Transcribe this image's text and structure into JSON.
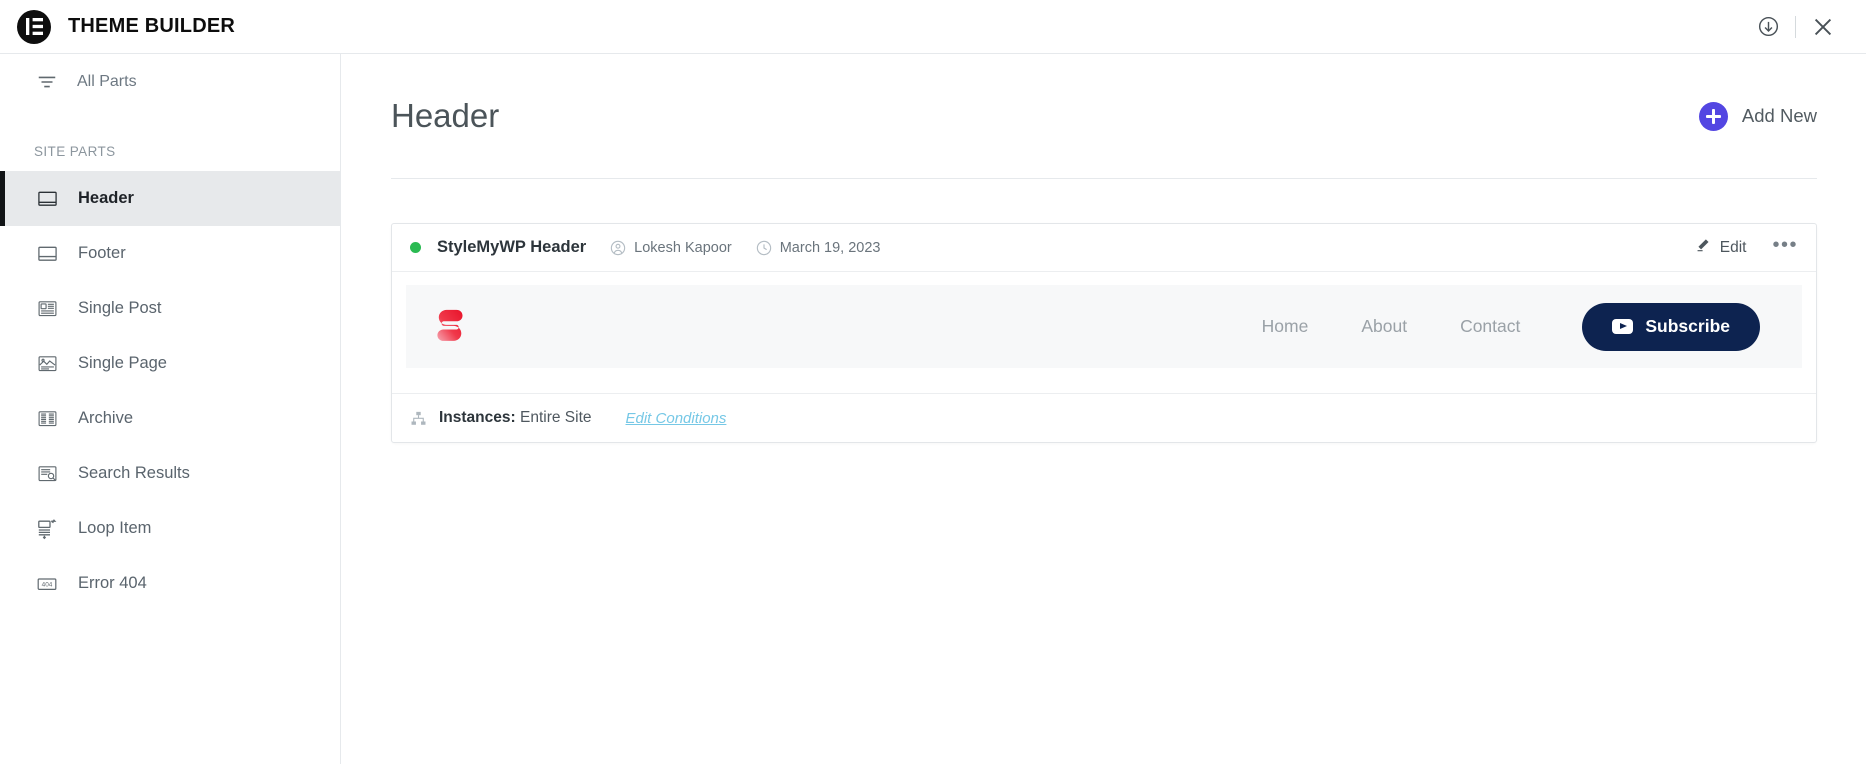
{
  "topbar": {
    "logo_icon": "elementor-logo-icon",
    "title": "THEME BUILDER",
    "save_icon": "download-circle-icon",
    "close_icon": "close-icon"
  },
  "sidebar": {
    "all_parts": {
      "label": "All Parts",
      "icon": "filter-lines-icon"
    },
    "section_label": "SITE PARTS",
    "items": [
      {
        "label": "Header",
        "icon": "header-block-icon",
        "active": true
      },
      {
        "label": "Footer",
        "icon": "footer-block-icon",
        "active": false
      },
      {
        "label": "Single Post",
        "icon": "single-post-icon",
        "active": false
      },
      {
        "label": "Single Page",
        "icon": "single-page-icon",
        "active": false
      },
      {
        "label": "Archive",
        "icon": "archive-grid-icon",
        "active": false
      },
      {
        "label": "Search Results",
        "icon": "search-results-icon",
        "active": false
      },
      {
        "label": "Loop Item",
        "icon": "loop-item-icon",
        "active": false
      },
      {
        "label": "Error 404",
        "icon": "error-404-icon",
        "active": false
      }
    ]
  },
  "main": {
    "page_title": "Header",
    "add_new": {
      "label": "Add New",
      "icon": "plus-circle-icon",
      "accent": "#5346e2"
    }
  },
  "card": {
    "status": {
      "icon": "status-dot",
      "color": "#2aba52"
    },
    "part_name": "StyleMyWP Header",
    "author": {
      "icon": "user-circle-icon",
      "name": "Lokesh Kapoor"
    },
    "date": {
      "icon": "clock-icon",
      "value": "March 19, 2023"
    },
    "edit": {
      "label": "Edit",
      "icon": "pencil-icon"
    },
    "more": {
      "label": "•••",
      "icon": "ellipsis-icon"
    },
    "preview": {
      "logo_icon": "stylemywp-s-logo",
      "nav": [
        "Home",
        "About",
        "Contact"
      ],
      "cta": {
        "label": "Subscribe",
        "icon": "youtube-play-icon",
        "bg": "#0d2350"
      }
    },
    "footer": {
      "icon": "sitemap-icon",
      "label": "Instances:",
      "value": "Entire Site",
      "link": "Edit Conditions",
      "link_color": "#76c8e6"
    }
  }
}
